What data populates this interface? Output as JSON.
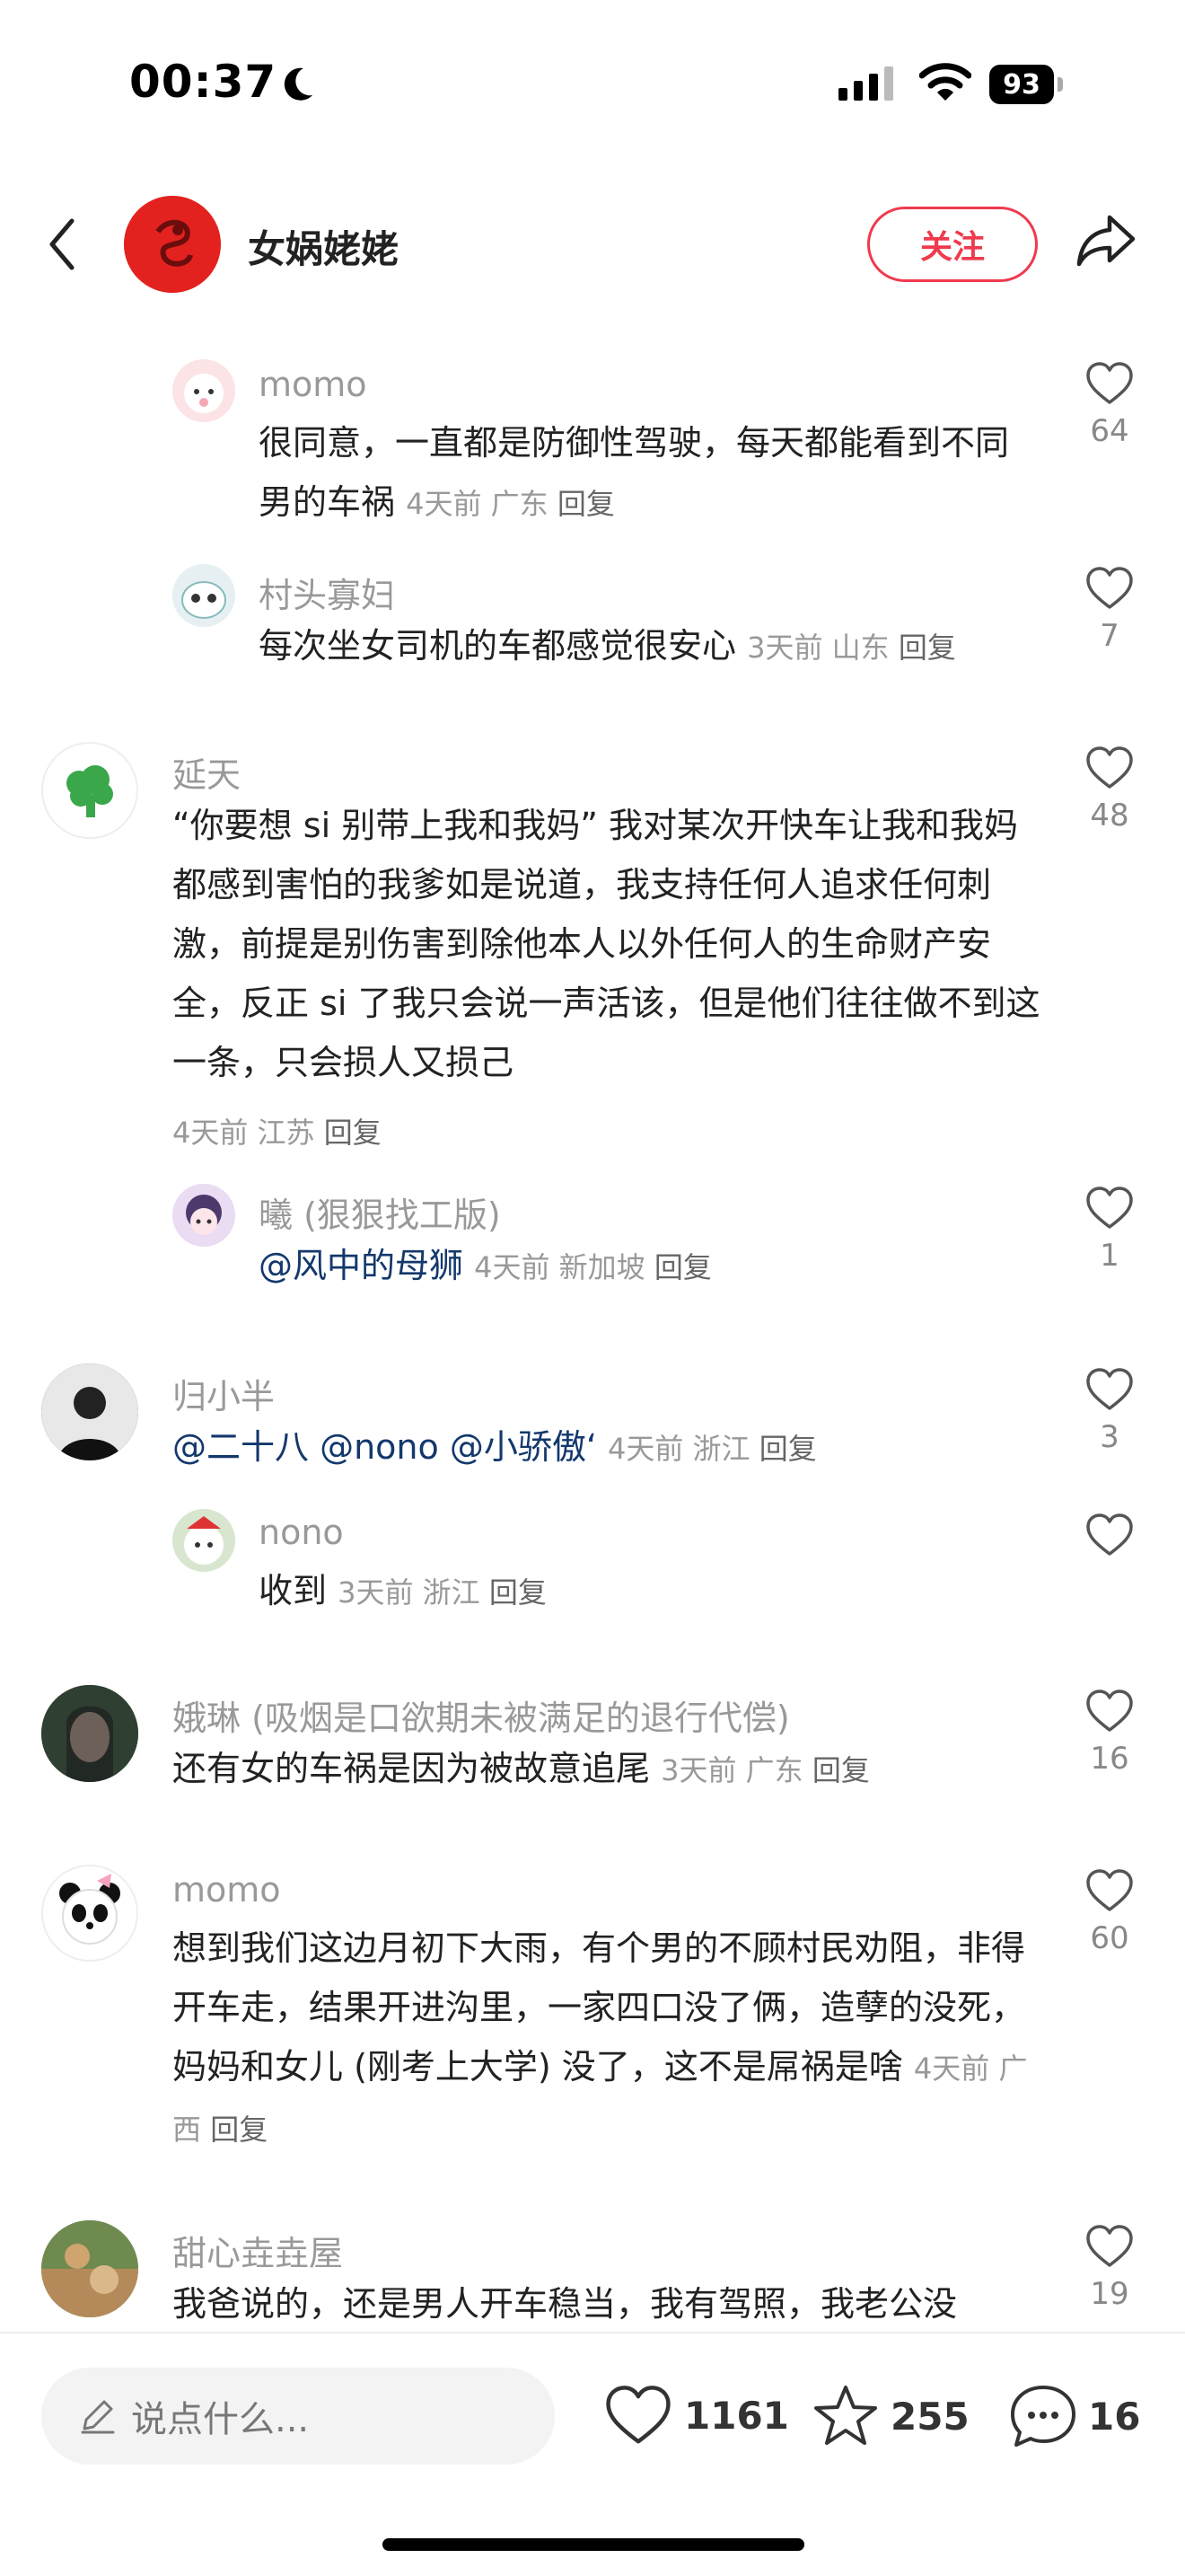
{
  "status_bar": {
    "time": "00:37",
    "battery": "93"
  },
  "header": {
    "author": "女娲姥姥",
    "follow_label": "关注"
  },
  "comments": [
    {
      "name": "momo",
      "text": "很同意，一直都是防御性驾驶，每天都能看到不同男的车祸",
      "meta": "4天前 广东",
      "reply": "回复",
      "likes": "64"
    },
    {
      "name": "村头寡妇",
      "text": "每次坐女司机的车都感觉很安心",
      "meta": "3天前 山东",
      "reply": "回复",
      "likes": "7"
    },
    {
      "name": "延天",
      "text": "“你要想 si 别带上我和我妈” 我对某次开快车让我和我妈都感到害怕的我爹如是说道，我支持任何人追求任何刺激，前提是别伤害到除他本人以外任何人的生命财产安全，反正 si 了我只会说一声活该，但是他们往往做不到这一条，只会损人又损己",
      "meta": "4天前 江苏",
      "reply": "回复",
      "likes": "48"
    },
    {
      "name": "曦 (狠狠找工版)",
      "mention": "@风中的母狮",
      "meta": "4天前 新加坡",
      "reply": "回复",
      "likes": "1"
    },
    {
      "name": "归小半",
      "mention": "@二十八 @nono @小骄傲‘",
      "meta": "4天前 浙江",
      "reply": "回复",
      "likes": "3"
    },
    {
      "name": "nono",
      "text": "收到",
      "meta": "3天前 浙江",
      "reply": "回复",
      "likes": ""
    },
    {
      "name": "娥琳 (吸烟是口欲期未被满足的退行代偿)",
      "text": "还有女的车祸是因为被故意追尾",
      "meta": "3天前 广东",
      "reply": "回复",
      "likes": "16"
    },
    {
      "name": "momo",
      "text": "想到我们这边月初下大雨，有个男的不顾村民劝阻，非得开车走，结果开进沟里，一家四口没了俩，造孽的没死，妈妈和女儿 (刚考上大学) 没了，这不是屌祸是啥",
      "meta": "4天前 广西",
      "reply": "回复",
      "likes": "60"
    },
    {
      "name": "甜心垚垚屋",
      "text": "我爸说的，还是男人开车稳当，我有驾照，我老公没",
      "likes": "19"
    }
  ],
  "bottom_bar": {
    "placeholder": "说点什么...",
    "likes": "1161",
    "stars": "255",
    "comments": "16"
  },
  "icons": [
    "back-icon",
    "share-icon",
    "heart-icon",
    "star-icon",
    "comment-icon",
    "pencil-icon",
    "moon-icon",
    "wifi-icon"
  ],
  "colors": {
    "accent": "#f03a4e",
    "avatar_red": "#e3221f",
    "mention": "#13386c"
  }
}
